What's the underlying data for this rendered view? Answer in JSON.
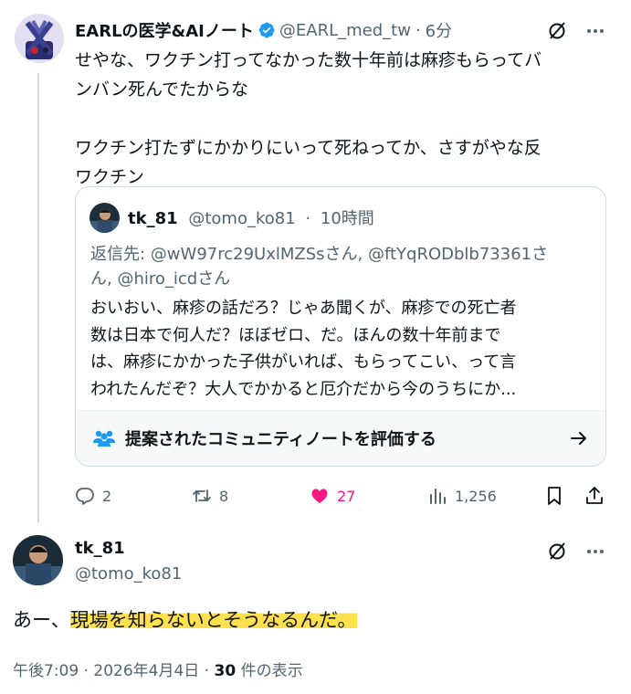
{
  "tweet1": {
    "name": "EARLの医学&AIノート",
    "handle": "@EARL_med_tw",
    "separator": "·",
    "time": "6分",
    "lines": [
      "せやな、ワクチン打ってなかった数十年前は麻疹もらってバ",
      "ンバン死んでたからな",
      "ワクチン打たずにかかりにいって死ねってか、さすがやな反",
      "ワクチン"
    ],
    "quote": {
      "name": "tk_81",
      "handle": "@tomo_ko81",
      "separator": "·",
      "time": "10時間",
      "reply_prefix": "返信先: ",
      "reply_line1": "@wW97rc29UxlMZSsさん, @ftYqRODblb73361さ",
      "reply_line2": "ん, @hiro_icdさん",
      "body": [
        "おいおい、麻疹の話だろ？じゃあ聞くが、麻疹での死亡者",
        "数は日本で何人だ？ほぼゼロ、だ。ほんの数十年前まで",
        "は、麻疹にかかった子供がいれば、もらってこい、って言",
        "われたんだぞ？大人でかかると厄介だから今のうちにか..."
      ],
      "note_label": "提案されたコミュニティノートを評価する"
    },
    "actions": {
      "replies": "2",
      "retweets": "8",
      "likes": "27",
      "views": "1,256"
    }
  },
  "tweet2": {
    "name": "tk_81",
    "handle": "@tomo_ko81",
    "text_plain": "あー、",
    "text_highlight": "現場を知らないとそうなるんだ。",
    "meta_time": "午後7:09 · 2026年4月4日 · ",
    "meta_views_count": "30",
    "meta_views_label": " 件の表示"
  },
  "colors": {
    "text": "#0f1419",
    "secondary": "#536471",
    "verified": "#1d9bf0",
    "like": "#f91880",
    "community": "#1d9bf0",
    "highlight": "#ffe14d"
  }
}
